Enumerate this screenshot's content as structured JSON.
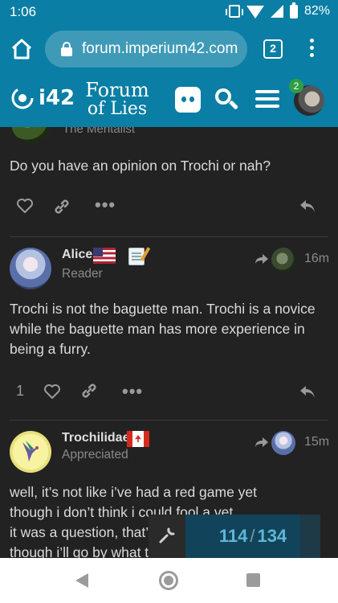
{
  "status_bar": {
    "time": "1:06",
    "battery": "82%"
  },
  "browser": {
    "url": "forum.imperium42.com",
    "tab_count": "2"
  },
  "forum_header": {
    "logo_i42": "i42",
    "logo_line1": "Forum",
    "logo_line2": "of Lies",
    "notification_count": "2"
  },
  "posts": [
    {
      "author_title": "The Mentalist",
      "text": "Do you have an opinion on Trochi or nah?"
    },
    {
      "author": "Alice",
      "author_title": "Reader",
      "time": "16m",
      "likes": "1",
      "text": "Trochi is not the baguette man. Trochi is a novice while the baguette man has more experience in being a furry."
    },
    {
      "author": "Trochilidae",
      "author_title": "Appreciated",
      "time": "15m",
      "lines": [
        "well, it’s not like i’ve had a red game yet",
        "though i don’t think i could fool a vet",
        "it was a question, that’",
        "though i’ll go by what t"
      ]
    }
  ],
  "progress": {
    "current": "114",
    "separator": "/",
    "total": "134",
    "fraction": 0.8507
  },
  "colors": {
    "brand": "#0a7ea4",
    "background": "#222222",
    "progress_text": "#5fb6d8"
  }
}
